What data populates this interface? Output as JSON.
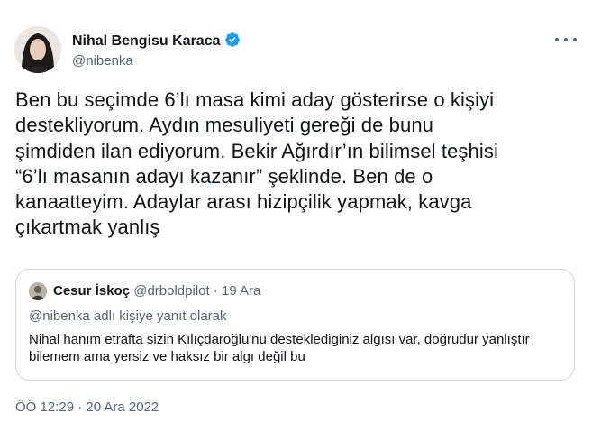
{
  "author": {
    "name": "Nihal Bengisu Karaca",
    "handle": "@nibenka",
    "verified": true
  },
  "tweet": {
    "text": "Ben bu seçimde 6’lı masa kimi aday gösterirse o kişiyi\ndestekliyorum. Aydın mesuliyeti gereği de bunu\nşimdiden ilan ediyorum. Bekir Ağırdır’ın bilimsel teşhisi\n“6’lı masanın adayı kazanır” şeklinde. Ben de o\nkanaatteyim. Adaylar arası hizipçilik yapmak, kavga\nçıkartmak yanlış",
    "timestamp": "ÖÖ 12:29 · 20 Ara 2022"
  },
  "quote": {
    "name": "Cesur İskoç",
    "handle": "@drboldpilot",
    "separator": " · ",
    "date": "19 Ara",
    "reply_to": "@nibenka adlı kişiye yanıt olarak",
    "text": "Nihal hanım etrafta sizin Kılıçdaroğlu'nu desteklediginiz algısı var, doğrudur yanlıştır bilemem ama yersiz ve haksız bir algı değil bu"
  },
  "colors": {
    "primary_text": "#0f1419",
    "secondary_text": "#536471",
    "verified_blue": "#1d9bf0",
    "border": "#cfd9de"
  },
  "icons": {
    "verified": "verified-badge-icon",
    "more": "more-options-icon"
  }
}
